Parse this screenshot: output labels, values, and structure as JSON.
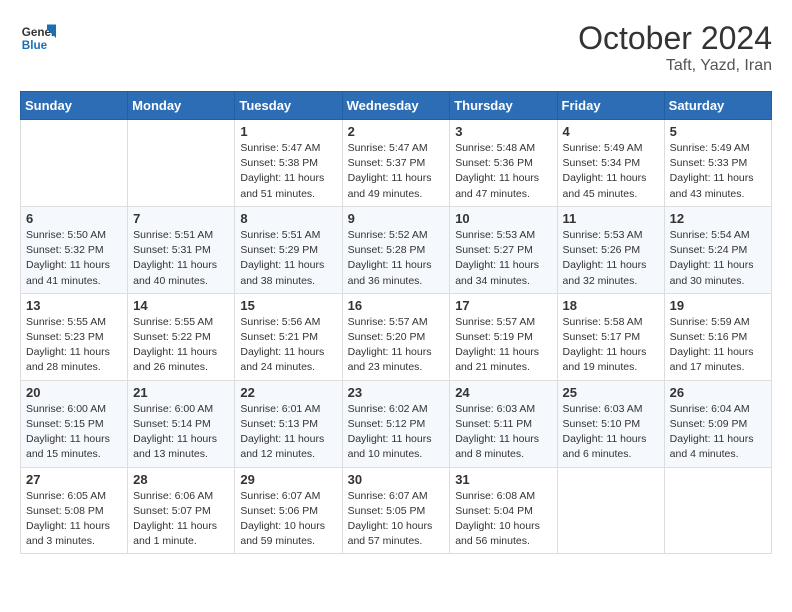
{
  "header": {
    "logo_general": "General",
    "logo_blue": "Blue",
    "month_title": "October 2024",
    "location": "Taft, Yazd, Iran"
  },
  "weekdays": [
    "Sunday",
    "Monday",
    "Tuesday",
    "Wednesday",
    "Thursday",
    "Friday",
    "Saturday"
  ],
  "weeks": [
    [
      {
        "day": "",
        "sunrise": "",
        "sunset": "",
        "daylight": ""
      },
      {
        "day": "",
        "sunrise": "",
        "sunset": "",
        "daylight": ""
      },
      {
        "day": "1",
        "sunrise": "Sunrise: 5:47 AM",
        "sunset": "Sunset: 5:38 PM",
        "daylight": "Daylight: 11 hours and 51 minutes."
      },
      {
        "day": "2",
        "sunrise": "Sunrise: 5:47 AM",
        "sunset": "Sunset: 5:37 PM",
        "daylight": "Daylight: 11 hours and 49 minutes."
      },
      {
        "day": "3",
        "sunrise": "Sunrise: 5:48 AM",
        "sunset": "Sunset: 5:36 PM",
        "daylight": "Daylight: 11 hours and 47 minutes."
      },
      {
        "day": "4",
        "sunrise": "Sunrise: 5:49 AM",
        "sunset": "Sunset: 5:34 PM",
        "daylight": "Daylight: 11 hours and 45 minutes."
      },
      {
        "day": "5",
        "sunrise": "Sunrise: 5:49 AM",
        "sunset": "Sunset: 5:33 PM",
        "daylight": "Daylight: 11 hours and 43 minutes."
      }
    ],
    [
      {
        "day": "6",
        "sunrise": "Sunrise: 5:50 AM",
        "sunset": "Sunset: 5:32 PM",
        "daylight": "Daylight: 11 hours and 41 minutes."
      },
      {
        "day": "7",
        "sunrise": "Sunrise: 5:51 AM",
        "sunset": "Sunset: 5:31 PM",
        "daylight": "Daylight: 11 hours and 40 minutes."
      },
      {
        "day": "8",
        "sunrise": "Sunrise: 5:51 AM",
        "sunset": "Sunset: 5:29 PM",
        "daylight": "Daylight: 11 hours and 38 minutes."
      },
      {
        "day": "9",
        "sunrise": "Sunrise: 5:52 AM",
        "sunset": "Sunset: 5:28 PM",
        "daylight": "Daylight: 11 hours and 36 minutes."
      },
      {
        "day": "10",
        "sunrise": "Sunrise: 5:53 AM",
        "sunset": "Sunset: 5:27 PM",
        "daylight": "Daylight: 11 hours and 34 minutes."
      },
      {
        "day": "11",
        "sunrise": "Sunrise: 5:53 AM",
        "sunset": "Sunset: 5:26 PM",
        "daylight": "Daylight: 11 hours and 32 minutes."
      },
      {
        "day": "12",
        "sunrise": "Sunrise: 5:54 AM",
        "sunset": "Sunset: 5:24 PM",
        "daylight": "Daylight: 11 hours and 30 minutes."
      }
    ],
    [
      {
        "day": "13",
        "sunrise": "Sunrise: 5:55 AM",
        "sunset": "Sunset: 5:23 PM",
        "daylight": "Daylight: 11 hours and 28 minutes."
      },
      {
        "day": "14",
        "sunrise": "Sunrise: 5:55 AM",
        "sunset": "Sunset: 5:22 PM",
        "daylight": "Daylight: 11 hours and 26 minutes."
      },
      {
        "day": "15",
        "sunrise": "Sunrise: 5:56 AM",
        "sunset": "Sunset: 5:21 PM",
        "daylight": "Daylight: 11 hours and 24 minutes."
      },
      {
        "day": "16",
        "sunrise": "Sunrise: 5:57 AM",
        "sunset": "Sunset: 5:20 PM",
        "daylight": "Daylight: 11 hours and 23 minutes."
      },
      {
        "day": "17",
        "sunrise": "Sunrise: 5:57 AM",
        "sunset": "Sunset: 5:19 PM",
        "daylight": "Daylight: 11 hours and 21 minutes."
      },
      {
        "day": "18",
        "sunrise": "Sunrise: 5:58 AM",
        "sunset": "Sunset: 5:17 PM",
        "daylight": "Daylight: 11 hours and 19 minutes."
      },
      {
        "day": "19",
        "sunrise": "Sunrise: 5:59 AM",
        "sunset": "Sunset: 5:16 PM",
        "daylight": "Daylight: 11 hours and 17 minutes."
      }
    ],
    [
      {
        "day": "20",
        "sunrise": "Sunrise: 6:00 AM",
        "sunset": "Sunset: 5:15 PM",
        "daylight": "Daylight: 11 hours and 15 minutes."
      },
      {
        "day": "21",
        "sunrise": "Sunrise: 6:00 AM",
        "sunset": "Sunset: 5:14 PM",
        "daylight": "Daylight: 11 hours and 13 minutes."
      },
      {
        "day": "22",
        "sunrise": "Sunrise: 6:01 AM",
        "sunset": "Sunset: 5:13 PM",
        "daylight": "Daylight: 11 hours and 12 minutes."
      },
      {
        "day": "23",
        "sunrise": "Sunrise: 6:02 AM",
        "sunset": "Sunset: 5:12 PM",
        "daylight": "Daylight: 11 hours and 10 minutes."
      },
      {
        "day": "24",
        "sunrise": "Sunrise: 6:03 AM",
        "sunset": "Sunset: 5:11 PM",
        "daylight": "Daylight: 11 hours and 8 minutes."
      },
      {
        "day": "25",
        "sunrise": "Sunrise: 6:03 AM",
        "sunset": "Sunset: 5:10 PM",
        "daylight": "Daylight: 11 hours and 6 minutes."
      },
      {
        "day": "26",
        "sunrise": "Sunrise: 6:04 AM",
        "sunset": "Sunset: 5:09 PM",
        "daylight": "Daylight: 11 hours and 4 minutes."
      }
    ],
    [
      {
        "day": "27",
        "sunrise": "Sunrise: 6:05 AM",
        "sunset": "Sunset: 5:08 PM",
        "daylight": "Daylight: 11 hours and 3 minutes."
      },
      {
        "day": "28",
        "sunrise": "Sunrise: 6:06 AM",
        "sunset": "Sunset: 5:07 PM",
        "daylight": "Daylight: 11 hours and 1 minute."
      },
      {
        "day": "29",
        "sunrise": "Sunrise: 6:07 AM",
        "sunset": "Sunset: 5:06 PM",
        "daylight": "Daylight: 10 hours and 59 minutes."
      },
      {
        "day": "30",
        "sunrise": "Sunrise: 6:07 AM",
        "sunset": "Sunset: 5:05 PM",
        "daylight": "Daylight: 10 hours and 57 minutes."
      },
      {
        "day": "31",
        "sunrise": "Sunrise: 6:08 AM",
        "sunset": "Sunset: 5:04 PM",
        "daylight": "Daylight: 10 hours and 56 minutes."
      },
      {
        "day": "",
        "sunrise": "",
        "sunset": "",
        "daylight": ""
      },
      {
        "day": "",
        "sunrise": "",
        "sunset": "",
        "daylight": ""
      }
    ]
  ]
}
